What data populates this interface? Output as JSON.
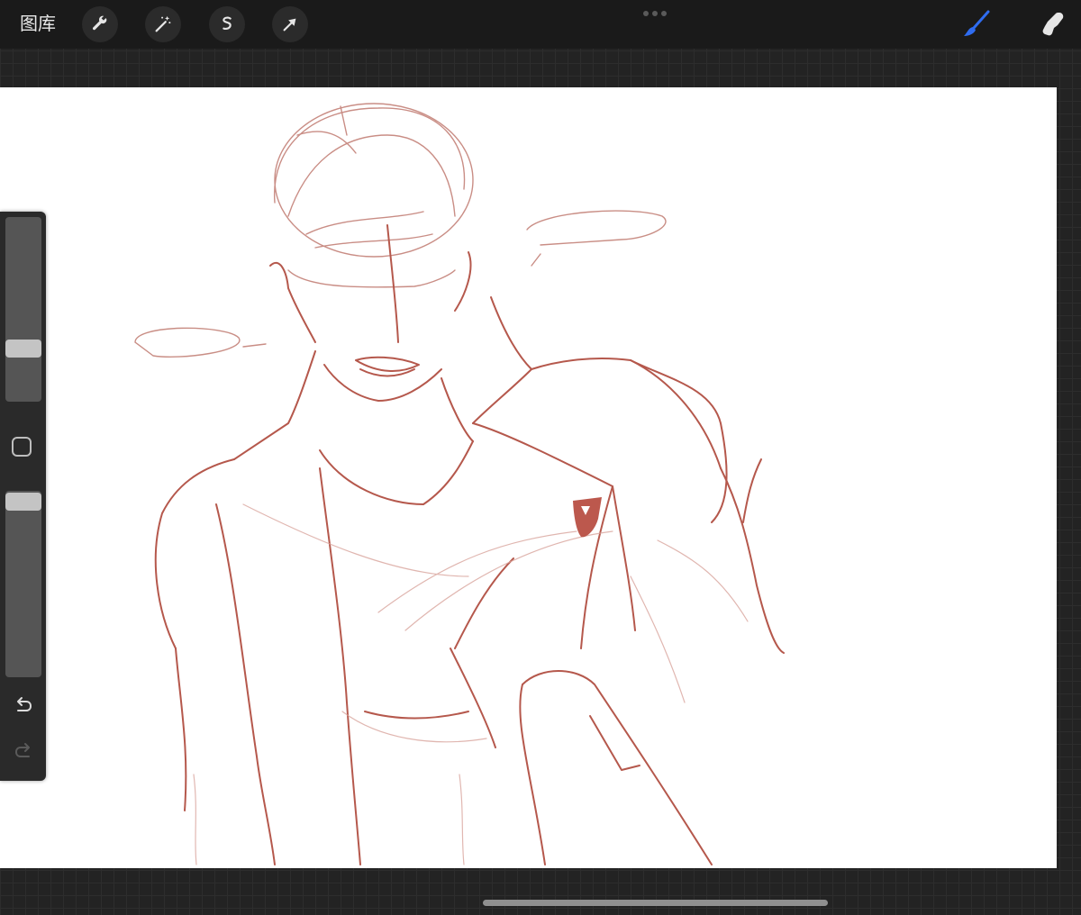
{
  "topbar": {
    "gallery_label": "图库",
    "tools_left": [
      "wrench-icon",
      "magic-wand-icon",
      "selection-icon",
      "move-arrow-icon"
    ],
    "tools_right": [
      "brush-icon",
      "smudge-icon"
    ],
    "active_color": "#2f6cf0"
  },
  "sidebar": {
    "size_slider_value": 0.35,
    "opacity_slider_value": 0.95,
    "buttons": [
      "modify-button",
      "undo-icon",
      "redo-icon"
    ]
  },
  "canvas": {
    "background": "#ffffff",
    "stroke_color": "#b5584c"
  }
}
